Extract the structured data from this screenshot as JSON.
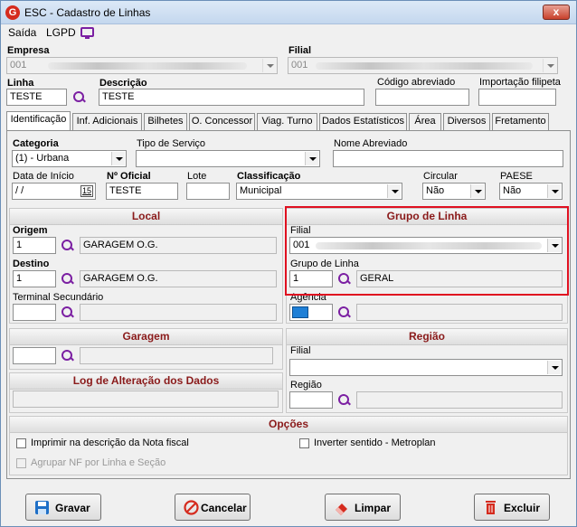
{
  "window": {
    "title": "ESC - Cadastro de Linhas",
    "app_icon_letter": "G",
    "close_label": "x"
  },
  "menu": {
    "items": [
      "Saída",
      "LGPD"
    ]
  },
  "header": {
    "empresa_label": "Empresa",
    "empresa_value": "001",
    "filial_label": "Filial",
    "filial_value": "001",
    "linha_label": "Linha",
    "linha_value": "TESTE",
    "descricao_label": "Descrição",
    "descricao_value": "TESTE",
    "codigo_abreviado_label": "Código abreviado",
    "importacao_label": "Importação filipeta"
  },
  "tabs": [
    "Identificação",
    "Inf. Adicionais",
    "Bilhetes",
    "O. Concessor",
    "Viag. Turno",
    "Dados Estatísticos",
    "Área",
    "Diversos",
    "Fretamento"
  ],
  "identificacao": {
    "categoria_label": "Categoria",
    "categoria_value": "(1) - Urbana",
    "tipo_servico_label": "Tipo de Serviço",
    "nome_abreviado_label": "Nome Abreviado",
    "data_inicio_label": "Data de Início",
    "data_inicio_value": " /  /",
    "calendar_label": "15",
    "n_oficial_label": "Nº Oficial",
    "n_oficial_value": "TESTE",
    "lote_label": "Lote",
    "classificacao_label": "Classificação",
    "classificacao_value": "Municipal",
    "circular_label": "Circular",
    "circular_value": "Não",
    "paese_label": "PAESE",
    "paese_value": "Não"
  },
  "local": {
    "title": "Local",
    "origem_label": "Origem",
    "origem_code": "1",
    "origem_name": "GARAGEM O.G.",
    "destino_label": "Destino",
    "destino_code": "1",
    "destino_name": "GARAGEM O.G.",
    "terminal_label": "Terminal Secundário"
  },
  "grupo_linha": {
    "title": "Grupo de Linha",
    "filial_label": "Filial",
    "filial_value": "001",
    "grupo_label": "Grupo de Linha",
    "grupo_code": "1",
    "grupo_name": "GERAL",
    "agencia_label": "Agência"
  },
  "garagem": {
    "title": "Garagem"
  },
  "regiao": {
    "title": "Região",
    "filial_label": "Filial",
    "regiao_label": "Região"
  },
  "log": {
    "title": "Log de Alteração dos Dados"
  },
  "opcoes": {
    "title": "Opções",
    "imprimir_label": "Imprimir na descrição da Nota fiscal",
    "inverter_label": "Inverter sentido - Metroplan",
    "agrupar_label": "Agrupar NF por Linha e Seção"
  },
  "buttons": {
    "gravar": "Gravar",
    "cancelar": "Cancelar",
    "limpar": "Limpar",
    "excluir": "Excluir"
  },
  "colors": {
    "accent": "#7b1fa2",
    "section_title": "#8a1a1a",
    "highlight": "#e01020"
  }
}
